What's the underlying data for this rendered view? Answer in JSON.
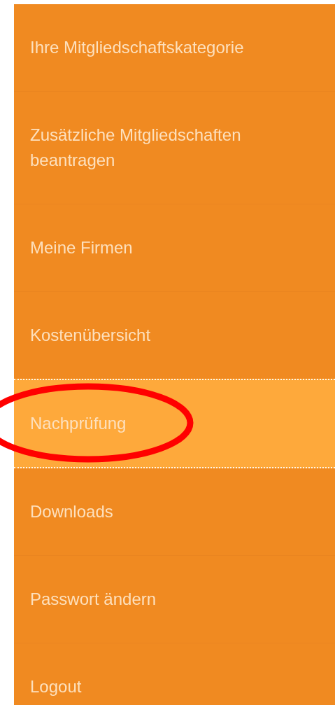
{
  "sidebar": {
    "items": [
      {
        "label": "Ihre Mitgliedschaftskategorie",
        "selected": false,
        "circled": false
      },
      {
        "label": "Zusätzliche Mitgliedschaften beantragen",
        "selected": false,
        "circled": false
      },
      {
        "label": "Meine Firmen",
        "selected": false,
        "circled": false
      },
      {
        "label": "Kostenübersicht",
        "selected": false,
        "circled": false
      },
      {
        "label": "Nachprüfung",
        "selected": true,
        "circled": true
      },
      {
        "label": "Downloads",
        "selected": false,
        "circled": false
      },
      {
        "label": "Passwort ändern",
        "selected": false,
        "circled": false
      },
      {
        "label": "Logout",
        "selected": false,
        "circled": false
      }
    ]
  }
}
